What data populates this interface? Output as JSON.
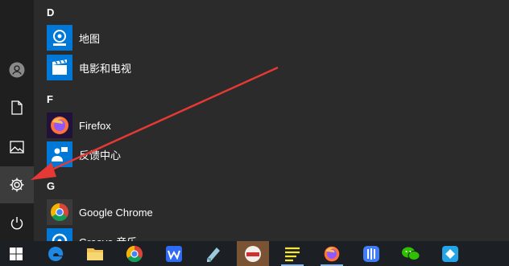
{
  "start_menu": {
    "sections": [
      {
        "letter": "D",
        "apps": [
          {
            "label": "地图",
            "icon": "maps-icon",
            "color": "#0078d7"
          },
          {
            "label": "电影和电视",
            "icon": "movies-tv-icon",
            "color": "#0078d7"
          }
        ]
      },
      {
        "letter": "F",
        "apps": [
          {
            "label": "Firefox",
            "icon": "firefox-icon",
            "color": "#20123a"
          },
          {
            "label": "反馈中心",
            "icon": "feedback-hub-icon",
            "color": "#0078d7"
          }
        ]
      },
      {
        "letter": "G",
        "apps": [
          {
            "label": "Google Chrome",
            "icon": "chrome-icon",
            "color": "#3a3a3a"
          },
          {
            "label": "Groove 音乐",
            "icon": "groove-music-icon",
            "color": "#0078d7"
          }
        ]
      }
    ]
  },
  "rail": {
    "items": [
      "user-icon",
      "documents-icon",
      "pictures-icon",
      "settings-icon",
      "power-icon"
    ]
  },
  "taskbar": {
    "items": [
      "windows-start-icon",
      "edge-icon",
      "file-explorer-icon",
      "chrome-icon",
      "wps-icon",
      "app-icon",
      "app-red-icon",
      "notes-icon",
      "firefox-icon",
      "app-blue-icon",
      "wechat-icon",
      "app-diamond-icon"
    ]
  },
  "annotation": {
    "color": "#e53935"
  }
}
